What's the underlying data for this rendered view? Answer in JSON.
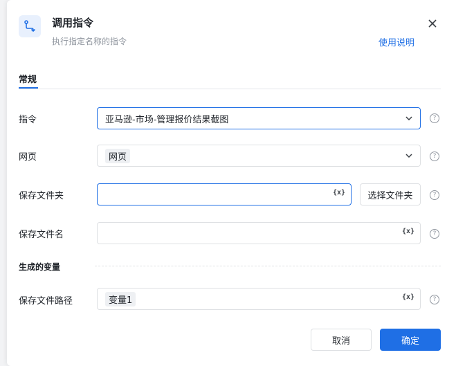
{
  "dialog": {
    "title": "调用指令",
    "subtitle": "执行指定名称的指令",
    "help_link": "使用说明",
    "icon": "flow-route-icon",
    "close_icon": "close-icon"
  },
  "tabs": [
    {
      "label": "常规",
      "active": true
    }
  ],
  "fields": {
    "command": {
      "label": "指令",
      "value": "亚马逊-市场-管理报价结果截图"
    },
    "webpage": {
      "label": "网页",
      "value": "网页"
    },
    "save_folder": {
      "label": "保存文件夹",
      "value": "",
      "var_icon": "{x}",
      "button": "选择文件夹"
    },
    "save_filename": {
      "label": "保存文件名",
      "value": "",
      "var_icon": "{x}"
    },
    "save_path": {
      "label": "保存文件路径",
      "value": "变量1",
      "var_icon": "{x}"
    }
  },
  "section": {
    "generated_vars": "生成的变量"
  },
  "help_icon": "?",
  "buttons": {
    "cancel": "取消",
    "ok": "确定"
  },
  "colors": {
    "accent": "#1f6fe5",
    "border": "#dee0e3",
    "muted": "#8f959e"
  }
}
